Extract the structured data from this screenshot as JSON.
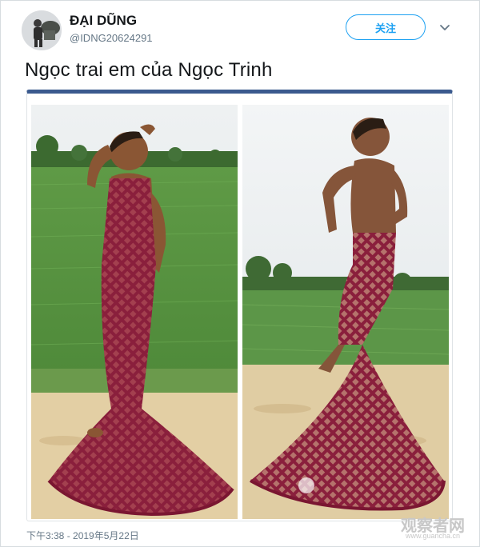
{
  "user": {
    "display_name": "ĐẠI DŨNG",
    "handle": "@IDNG20624291"
  },
  "follow_button": {
    "label": "关注"
  },
  "tweet": {
    "text": "Ngọc trai em của Ngọc Trinh",
    "timestamp": "下午3:38 - 2019年5月22日"
  },
  "media": {
    "photos": [
      "photo-left",
      "photo-right"
    ]
  },
  "watermark": {
    "text": "观察者网",
    "sub": "www.guancha.cn"
  },
  "icons": {
    "avatar": "avatar-photo",
    "menu": "chevron-down-icon"
  },
  "colors": {
    "accent": "#1da1f2",
    "media_border": "#3b5a8e",
    "muted": "#657786"
  }
}
